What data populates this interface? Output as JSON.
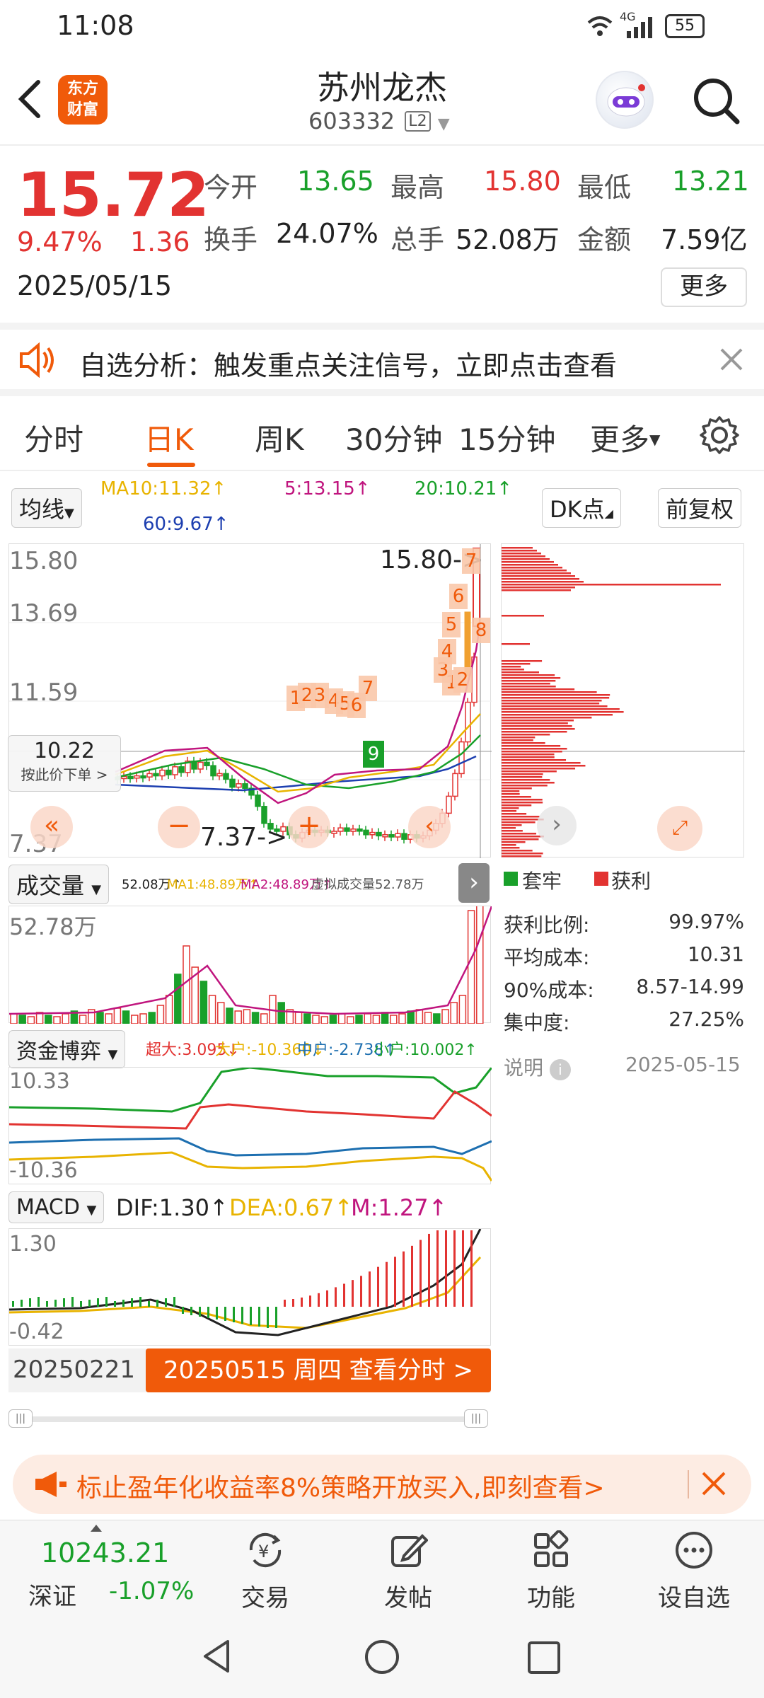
{
  "status": {
    "time": "11:08",
    "net": "4G",
    "battery": "55"
  },
  "header": {
    "logo_line1": "东方",
    "logo_line2": "财富",
    "stock_name": "苏州龙杰",
    "stock_code": "603332",
    "level": "L2"
  },
  "quote": {
    "price": "15.72",
    "change_pct": "9.47%",
    "change_abs": "1.36",
    "date": "2025/05/15",
    "open_label": "今开",
    "open": "13.65",
    "high_label": "最高",
    "high": "15.80",
    "low_label": "最低",
    "low": "13.21",
    "turnover_label": "换手",
    "turnover": "24.07%",
    "volume_label": "总手",
    "volume": "52.08万",
    "amount_label": "金额",
    "amount": "7.59亿",
    "more": "更多"
  },
  "banner": {
    "text": "自选分析：触发重点关注信号，立即点击查看"
  },
  "tabs": [
    "分时",
    "日K",
    "周K",
    "30分钟",
    "15分钟",
    "更多"
  ],
  "active_tab": "日K",
  "ma": {
    "chip": "均线",
    "ma10": "MA10:11.32↑",
    "ma5": "5:13.15↑",
    "ma20": "20:10.21↑",
    "ma60": "60:9.67↑",
    "dk": "DK点",
    "fq": "前复权"
  },
  "kline": {
    "y_top": "15.80",
    "y_2": "13.69",
    "y_3": "11.59",
    "y_bottom": "7.37",
    "high_marker": "15.80->",
    "low_marker": "7.37->",
    "cursor_price": "10.22",
    "cursor_hint": "按此价下单 >"
  },
  "colors": {
    "up": "#e23331",
    "down": "#19a02a",
    "accent": "#f05a0a",
    "ma5": "#c0157e",
    "ma10": "#e8b300",
    "ma20": "#19a02a",
    "ma60": "#1d3fb0"
  },
  "chip_dist": {
    "legend_trapped": "套牢",
    "legend_profit": "获利",
    "rows": [
      {
        "label": "获利比例:",
        "value": "99.97%"
      },
      {
        "label": "平均成本:",
        "value": "10.31"
      },
      {
        "label": "90%成本:",
        "value": "8.57-14.99"
      },
      {
        "label": "集中度:",
        "value": "27.25%"
      }
    ],
    "explain": "说明",
    "date": "2025-05-15"
  },
  "volume_panel": {
    "chip": "成交量",
    "v": "52.08万↑",
    "ma1": "MA1:48.89万↑",
    "ma2": "MA2:48.89万↑",
    "virtual": "虚拟成交量52.78万",
    "y_top": "52.78万"
  },
  "money_panel": {
    "chip": "资金博弈",
    "super": "超大:3.095↓",
    "big": "大户:-10.360↓",
    "mid": "中户:-2.738↑",
    "small": "小户:10.002↑",
    "y_top": "10.33",
    "y_bottom": "-10.36"
  },
  "macd_panel": {
    "chip": "MACD",
    "dif": "DIF:1.30↑",
    "dea": "DEA:0.67↑",
    "m": "M:1.27↑",
    "y_top": "1.30",
    "y_bottom": "-0.42"
  },
  "date_bar": {
    "start": "20250221",
    "end_button": "20250515 周四 查看分时 >"
  },
  "ad": {
    "text": "标止盈年化收益率8%策略开放买入,即刻查看>"
  },
  "bottom_nav": {
    "index_value": "10243.21",
    "index_name": "深证",
    "index_change": "-1.07%",
    "items": [
      "交易",
      "发帖",
      "功能",
      "设自选"
    ]
  },
  "numbers_labels": [
    "1",
    "2",
    "3",
    "4",
    "5",
    "6",
    "7",
    "8"
  ]
}
